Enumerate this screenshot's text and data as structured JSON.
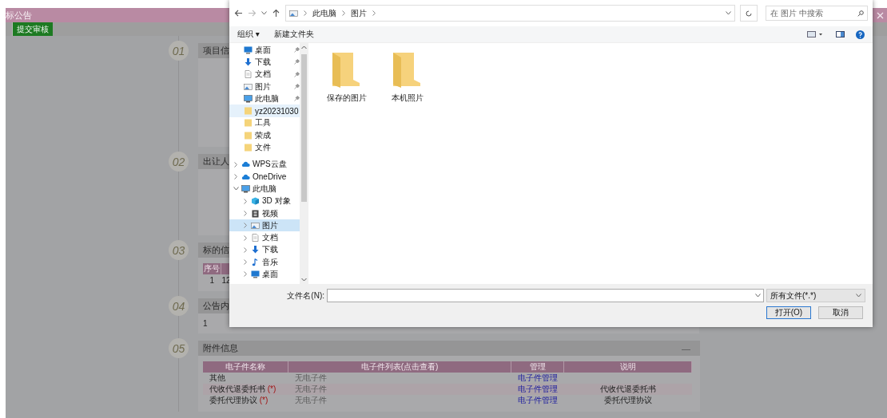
{
  "page": {
    "title": "标公告",
    "toolbar": [
      {
        "label": "提交审核"
      }
    ],
    "sections": [
      {
        "number": "01",
        "title": "项目信"
      },
      {
        "number": "02",
        "title": "出让人"
      },
      {
        "number": "03",
        "title": "标的信",
        "table": {
          "columns": [
            "序号"
          ],
          "rows": [
            [
              "1",
              "12"
            ]
          ]
        }
      },
      {
        "number": "04",
        "title": "公告内",
        "text": "1"
      },
      {
        "number": "05",
        "title": "附件信息",
        "collapse": "—",
        "attachments": {
          "columns": [
            "电子件名称",
            "电子件列表(点击查看)",
            "管理",
            "说明"
          ],
          "rows": [
            {
              "name": "其他",
              "files": "无电子件",
              "manage": "电子件管理"
            },
            {
              "name": "代收代退委托书",
              "required_mark": "(*)",
              "files": "无电子件",
              "manage": "电子件管理",
              "note": "代收代退委托书"
            },
            {
              "name": "委托代理协议",
              "required_mark": "(*)",
              "files": "无电子件",
              "manage": "电子件管理",
              "note": "委托代理协议"
            }
          ]
        }
      }
    ]
  },
  "dialog": {
    "breadcrumb": [
      "此电脑",
      "图片"
    ],
    "search": {
      "placeholder": "在 图片 中搜索"
    },
    "toolbar": {
      "organize": "组织 ▾",
      "new_folder": "新建文件夹"
    },
    "quick_access": [
      {
        "label": "桌面",
        "kind": "desktop",
        "pinned": true,
        "hovered": false
      },
      {
        "label": "下载",
        "kind": "download",
        "pinned": true,
        "hovered": false
      },
      {
        "label": "文档",
        "kind": "document",
        "pinned": true,
        "hovered": false
      },
      {
        "label": "图片",
        "kind": "picture",
        "pinned": true,
        "hovered": false
      },
      {
        "label": "此电脑",
        "kind": "computer",
        "pinned": true,
        "hovered": false
      },
      {
        "label": "yz20231030",
        "kind": "folder",
        "pinned": false,
        "hovered": true
      },
      {
        "label": "工具",
        "kind": "folder",
        "pinned": false,
        "hovered": false
      },
      {
        "label": "荣成",
        "kind": "folder",
        "pinned": false,
        "hovered": false
      },
      {
        "label": "文件",
        "kind": "folder",
        "pinned": false,
        "hovered": false
      }
    ],
    "tree": [
      {
        "label": "WPS云盘",
        "kind": "cloud",
        "expanded": false,
        "selected": false
      },
      {
        "label": "OneDrive",
        "kind": "cloud",
        "expanded": false,
        "selected": false
      },
      {
        "label": "此电脑",
        "kind": "computer",
        "expanded": true,
        "selected": false,
        "children": [
          {
            "label": "3D 对象",
            "kind": "cube",
            "expanded": false,
            "selected": false
          },
          {
            "label": "视频",
            "kind": "film",
            "expanded": false,
            "selected": false
          },
          {
            "label": "图片",
            "kind": "picture",
            "expanded": false,
            "selected": true
          },
          {
            "label": "文档",
            "kind": "document",
            "expanded": false,
            "selected": false
          },
          {
            "label": "下载",
            "kind": "download",
            "expanded": false,
            "selected": false
          },
          {
            "label": "音乐",
            "kind": "music",
            "expanded": false,
            "selected": false
          },
          {
            "label": "桌面",
            "kind": "desktop",
            "expanded": false,
            "selected": false
          }
        ]
      }
    ],
    "folders": [
      {
        "label": "保存的图片"
      },
      {
        "label": "本机照片"
      }
    ],
    "filename": {
      "label": "文件名(N):"
    },
    "filter": "所有文件(*.*)",
    "buttons": [
      {
        "label": "打开(O)",
        "default": true
      },
      {
        "label": "取消",
        "default": false
      }
    ]
  }
}
